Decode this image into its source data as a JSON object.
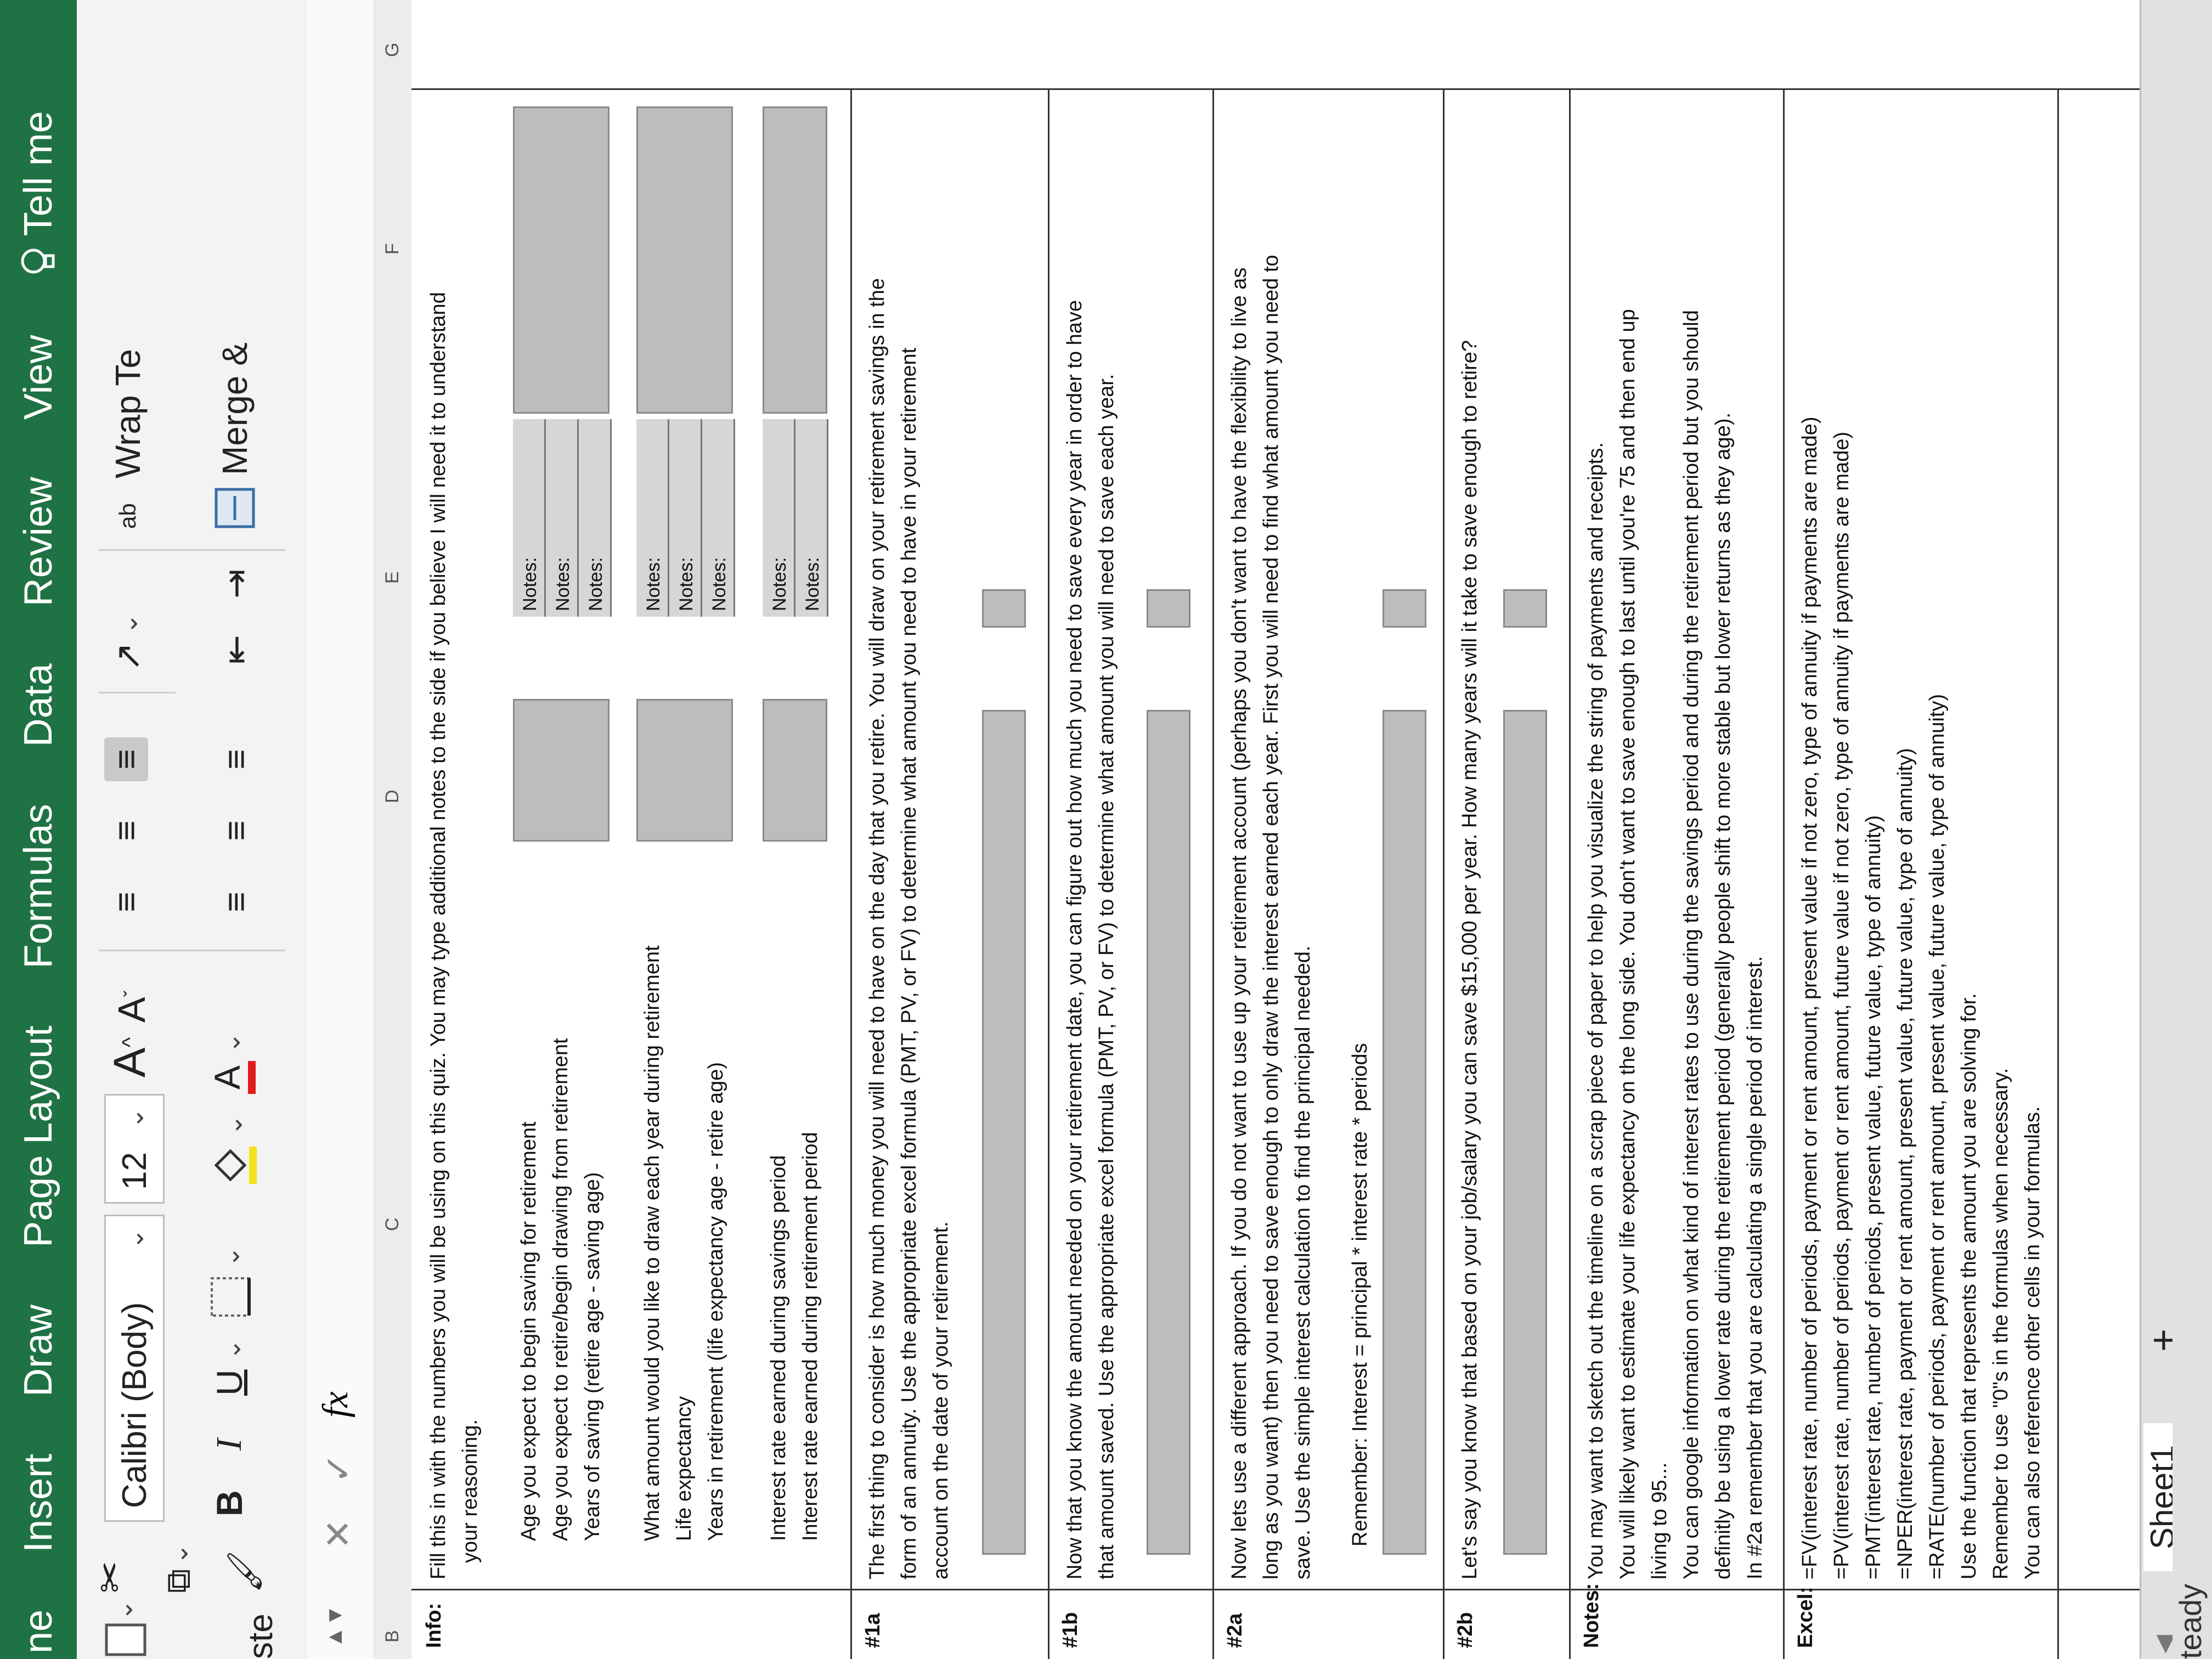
{
  "tabs": [
    "ne",
    "Insert",
    "Draw",
    "Page Layout",
    "Formulas",
    "Data",
    "Review",
    "View"
  ],
  "tell_me": "Tell me",
  "ribbon": {
    "paste_label": "ste",
    "font_name": "Calibri (Body)",
    "font_size": "12",
    "bold": "B",
    "italic": "I",
    "underline": "U",
    "grow_font": "A",
    "shrink_font": "A",
    "font_color": "A",
    "wrap_text": "Wrap Te",
    "merge": "Merge &",
    "wrap_icon_text": "ab"
  },
  "formula_bar": {
    "fx": "fx"
  },
  "columns": [
    "B",
    "C",
    "D",
    "E",
    "F",
    "G"
  ],
  "rows": {
    "info": {
      "label": "Info:",
      "text": [
        "Fill this in with the numbers you will be using on this quiz. You may type additional notes to the side if you believe I will need it to understand",
        "your reasoning."
      ],
      "group1": [
        "Age you expect to begin saving for retirement",
        "Age you expect to retire/begin drawing from retirement",
        "Years of saving (retire age - saving age)"
      ],
      "group2": [
        "What amount would you like to draw each year during retirement",
        "Life expectancy",
        "Years in retirement (life expectancy age - retire age)"
      ],
      "group3": [
        "Interest rate earned during savings period",
        "Interest rate earned during retirement period"
      ],
      "notes_label": "Notes:"
    },
    "r1a": {
      "label": "#1a",
      "text": [
        "The first thing to consider is how much money you will need to have on the day that you retire. You will draw on your retirement savings in the",
        "form of an annuity. Use the appropriate excel formula (PMT, PV, or FV) to determine what amount you need to have in your retirement",
        "account on the date of your retirement."
      ]
    },
    "r1b": {
      "label": "#1b",
      "text": [
        "Now that you know the amount needed on your retirement date, you can figure out how much you need to save every year in order to have",
        "that amount saved. Use the appropriate excel formula (PMT, PV, or FV) to determine what amount you will need to save each year."
      ]
    },
    "r2a": {
      "label": "#2a",
      "text": [
        "Now lets use a different approach. If you do not want to use up your retirement account (perhaps you don't want to have the flexibility to live as",
        "long as you want) then you need to save enough to only draw the interest earned each year. First you will need to find what amount you need to",
        "save. Use the simple interest calculation to find the principal needed.",
        "",
        "Remember:  Interest = principal * interest rate * periods"
      ]
    },
    "r2b": {
      "label": "#2b",
      "text": [
        "Let's say you know that based on your job/salary you can save $15,000 per year. How many years will it take to save enough to retire?"
      ]
    },
    "notes": {
      "label": "Notes:",
      "text": [
        "You may want to sketch out the timeline on a scrap piece of paper to help you visualize the string of payments and receipts.",
        "You will likely want to estimate your life expectancy on the long side. You don't want to save enough to last until you're 75 and then end up",
        "living to 95...",
        "You can google information on what kind of interest rates to use during the savings period and during the retirement period but you should",
        "definitly be using a lower rate during the retirement period (generally people shift to more stable but lower returns as they age).",
        "In #2a remember that you are calculating a single period of interest."
      ]
    },
    "excel": {
      "label": "Excel:",
      "text": [
        "=FV(interest rate, number of periods, payment or rent amount, present value if not zero, type of annuity if payments are made)",
        "=PV(interest rate, number of periods, payment or rent amount, future value if not zero, type of annuity if payments are made)",
        "=PMT(interest rate, number of periods, present value, future value, type of annuity)",
        "=NPER(interest rate, payment or rent amount, present value, future value, type of annuity)",
        "=RATE(number of periods, payment or rent amount, present value, future value, type of annuity)",
        "Use the function that represents the amount you are solving for.",
        "Remember to use \"0\"s in the formulas when necessary.",
        "You can also reference other cells in your formulas."
      ]
    }
  },
  "sheet_tab": "Sheet1",
  "add_sheet": "+",
  "status": "teady"
}
